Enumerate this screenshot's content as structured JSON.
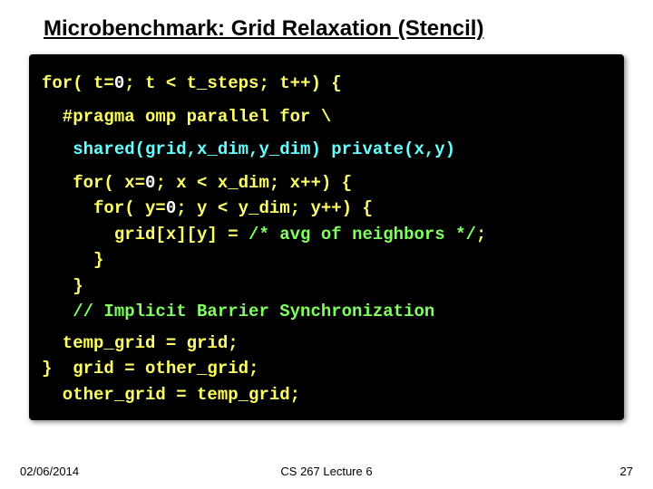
{
  "title": "Microbenchmark: Grid Relaxation (Stencil)",
  "code": {
    "l1a": "for( t=",
    "l1b": "0",
    "l1c": "; t < t_steps; t++) {",
    "l2": "  #pragma omp parallel for \\",
    "l3": "   shared(grid,x_dim,y_dim) private(x,y)",
    "l4a": "   for( x=",
    "l4b": "0",
    "l4c": "; x < x_dim; x++) {",
    "l5a": "     for( y=",
    "l5b": "0",
    "l5c": "; y < y_dim; y++) {",
    "l6a": "       grid[x][y] = ",
    "l6b": "/* avg of neighbors */",
    "l6c": ";",
    "l7": "     }",
    "l8": "   }",
    "l9": "   // Implicit Barrier Synchronization",
    "l10": "  temp_grid = grid;",
    "l11": "  grid = other_grid;",
    "l12": "  other_grid = temp_grid;",
    "l13": "}"
  },
  "footer": {
    "date": "02/06/2014",
    "center": "CS 267 Lecture 6",
    "page": "27"
  }
}
